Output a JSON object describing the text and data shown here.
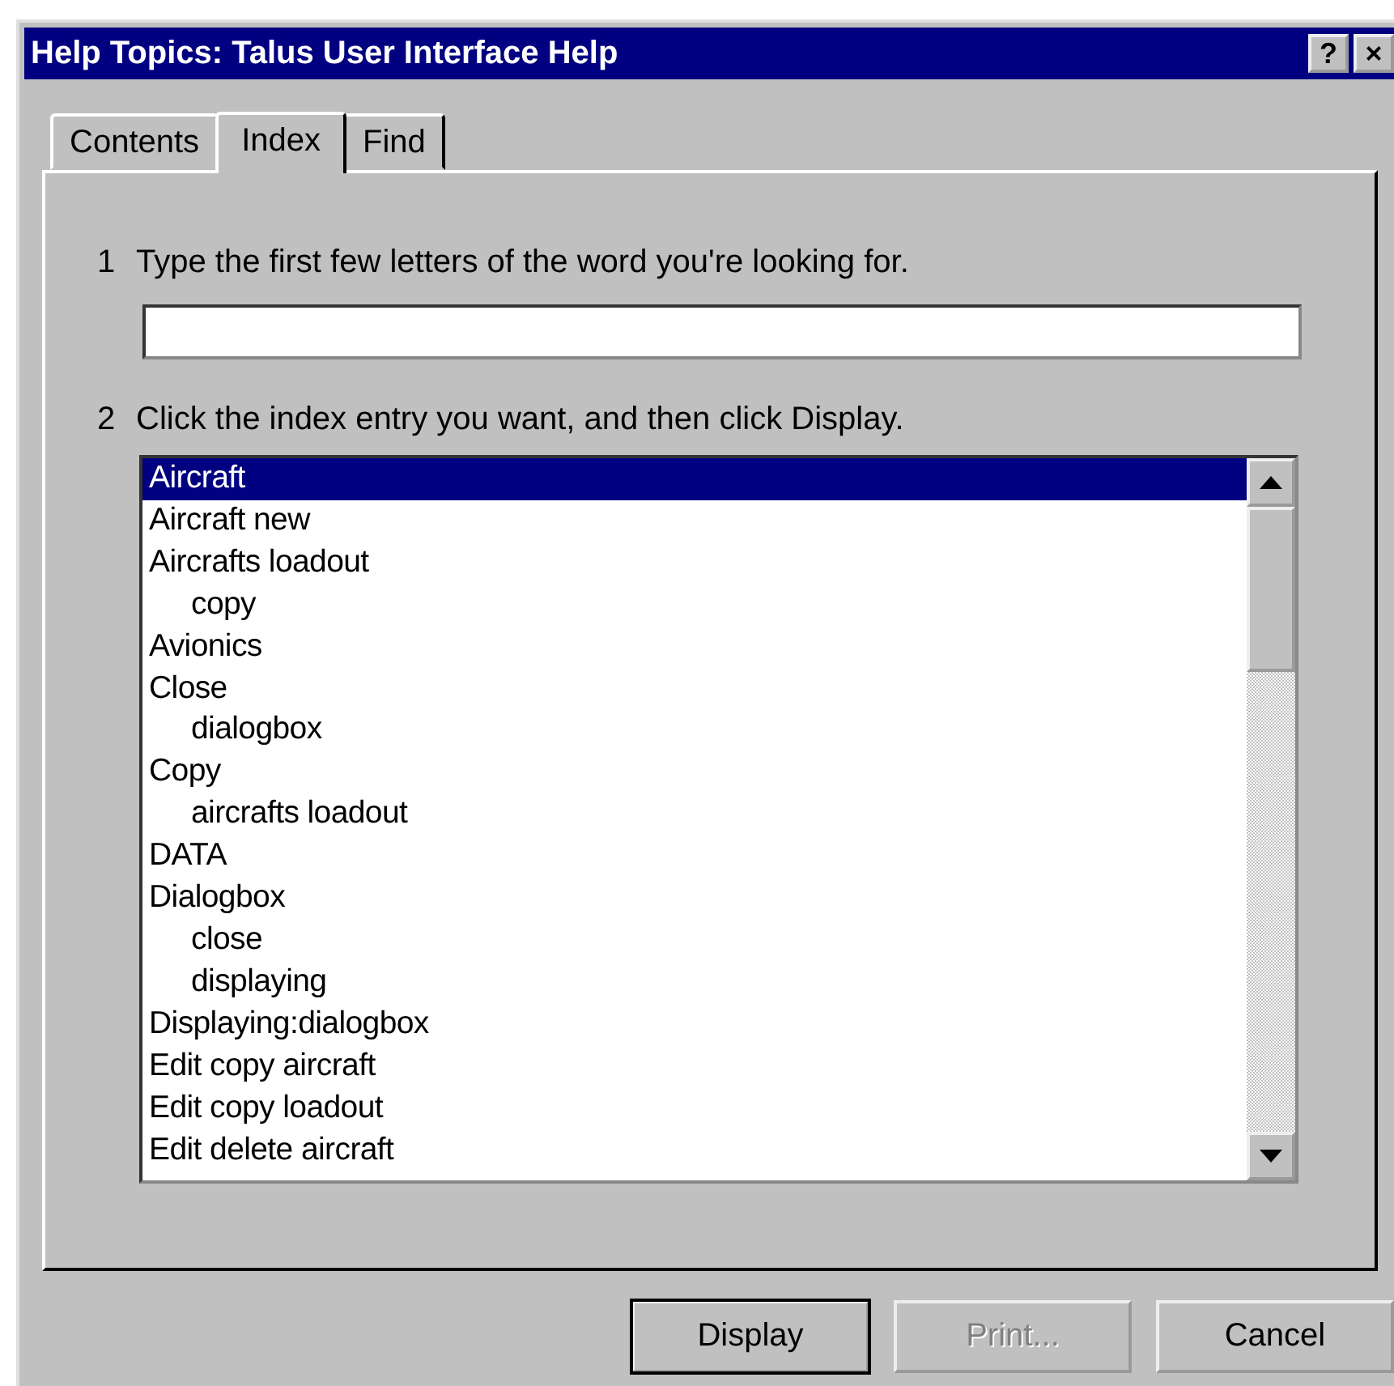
{
  "window": {
    "title": "Help Topics: Talus User Interface Help",
    "title_buttons": [
      "?",
      "×"
    ]
  },
  "tabs": [
    {
      "label": "Contents",
      "selected": false
    },
    {
      "label": "Index",
      "selected": true
    },
    {
      "label": "Find",
      "selected": false
    }
  ],
  "step_1": {
    "number": "1",
    "text": "Type the first few letters of the word you're looking for."
  },
  "step_2": {
    "number": "2",
    "text": "Click the index entry you want, and then click Display."
  },
  "index_entries": [
    {
      "label": "Aircraft",
      "selected": true
    },
    {
      "label": "Aircraft new",
      "selected": false
    },
    {
      "label": "Aircrafts loadout",
      "selected": false,
      "children": [
        {
          "label": "copy",
          "selected": false
        }
      ]
    },
    {
      "label": "Avionics",
      "selected": false
    },
    {
      "label": "Close",
      "selected": false,
      "children": [
        {
          "label": "dialogbox",
          "selected": false
        }
      ]
    },
    {
      "label": "Copy",
      "selected": false,
      "children": [
        {
          "label": "aircrafts loadout",
          "selected": false
        }
      ]
    },
    {
      "label": "DATA",
      "selected": false
    },
    {
      "label": "Dialogbox",
      "selected": false,
      "children": [
        {
          "label": "close",
          "selected": false
        },
        {
          "label": "displaying",
          "selected": false
        }
      ]
    },
    {
      "label": "Displaying:dialogbox",
      "selected": false
    },
    {
      "label": "Edit copy aircraft",
      "selected": false
    },
    {
      "label": "Edit copy loadout",
      "selected": false
    },
    {
      "label": "Edit delete aircraft",
      "selected": false
    }
  ],
  "buttons": [
    {
      "label": "Display",
      "disabled": false,
      "default": true
    },
    {
      "label": "Print...",
      "disabled": true,
      "default": false
    },
    {
      "label": "Cancel",
      "disabled": false,
      "default": false
    }
  ]
}
